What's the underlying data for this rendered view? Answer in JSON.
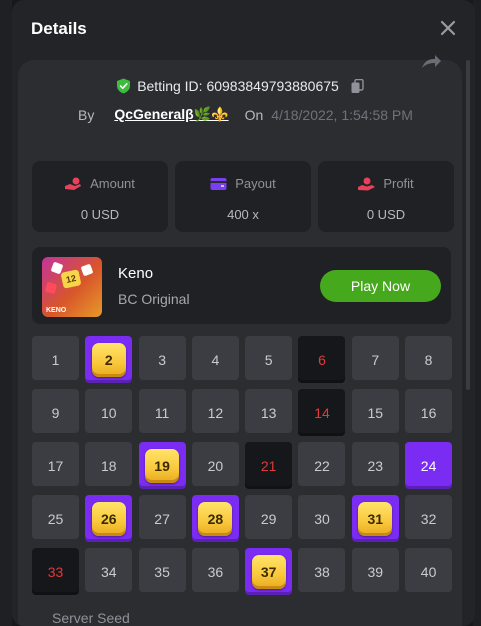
{
  "modal": {
    "title": "Details"
  },
  "bet": {
    "id_label": "Betting ID: 60983849793880675",
    "by_label": "By",
    "user": "QcGeneralβ🌿⚜️",
    "on_label": "On",
    "date": "4/18/2022, 1:54:58 PM"
  },
  "stats": [
    {
      "label": "Amount",
      "value": "0 USD",
      "icon": "coins-hand-icon",
      "color": "#e8415a"
    },
    {
      "label": "Payout",
      "value": "400 x",
      "icon": "wallet-icon",
      "color": "#7b3ff2"
    },
    {
      "label": "Profit",
      "value": "0 USD",
      "icon": "profit-hand-icon",
      "color": "#e8415a"
    }
  ],
  "game": {
    "name": "Keno",
    "provider": "BC Original",
    "play_label": "Play Now",
    "thumb_text": "KENO",
    "thumb_tile": "12"
  },
  "grid": {
    "cells": [
      {
        "n": "1",
        "s": "normal"
      },
      {
        "n": "2",
        "s": "hit"
      },
      {
        "n": "3",
        "s": "normal"
      },
      {
        "n": "4",
        "s": "normal"
      },
      {
        "n": "5",
        "s": "normal"
      },
      {
        "n": "6",
        "s": "dark"
      },
      {
        "n": "7",
        "s": "normal"
      },
      {
        "n": "8",
        "s": "normal"
      },
      {
        "n": "9",
        "s": "normal"
      },
      {
        "n": "10",
        "s": "normal"
      },
      {
        "n": "11",
        "s": "normal"
      },
      {
        "n": "12",
        "s": "normal"
      },
      {
        "n": "13",
        "s": "normal"
      },
      {
        "n": "14",
        "s": "dark"
      },
      {
        "n": "15",
        "s": "normal"
      },
      {
        "n": "16",
        "s": "normal"
      },
      {
        "n": "17",
        "s": "normal"
      },
      {
        "n": "18",
        "s": "normal"
      },
      {
        "n": "19",
        "s": "hit"
      },
      {
        "n": "20",
        "s": "normal"
      },
      {
        "n": "21",
        "s": "dark"
      },
      {
        "n": "22",
        "s": "normal"
      },
      {
        "n": "23",
        "s": "normal"
      },
      {
        "n": "24",
        "s": "selected"
      },
      {
        "n": "25",
        "s": "normal"
      },
      {
        "n": "26",
        "s": "hit"
      },
      {
        "n": "27",
        "s": "normal"
      },
      {
        "n": "28",
        "s": "hit"
      },
      {
        "n": "29",
        "s": "normal"
      },
      {
        "n": "30",
        "s": "normal"
      },
      {
        "n": "31",
        "s": "hit"
      },
      {
        "n": "32",
        "s": "normal"
      },
      {
        "n": "33",
        "s": "dark"
      },
      {
        "n": "34",
        "s": "normal"
      },
      {
        "n": "35",
        "s": "normal"
      },
      {
        "n": "36",
        "s": "normal"
      },
      {
        "n": "37",
        "s": "hit"
      },
      {
        "n": "38",
        "s": "normal"
      },
      {
        "n": "39",
        "s": "normal"
      },
      {
        "n": "40",
        "s": "normal"
      }
    ]
  },
  "seed": {
    "label": "Server Seed"
  },
  "colors": {
    "accent_purple": "#7a2cf3",
    "play_green": "#46a81c",
    "miss_red": "#e23a3a",
    "gem_yellow": "#f9c73a"
  }
}
